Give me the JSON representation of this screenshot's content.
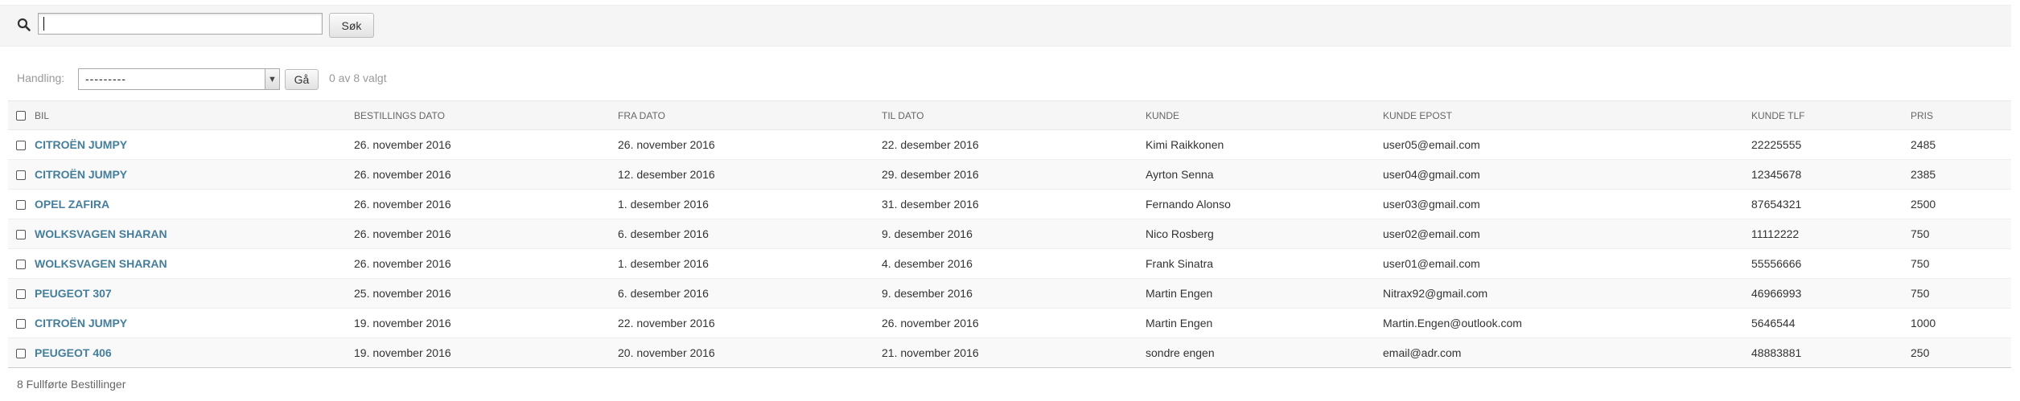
{
  "search": {
    "input_value": "",
    "button_label": "Søk"
  },
  "actions": {
    "label": "Handling:",
    "selected_option": "---------",
    "go_label": "Gå",
    "selection_count": "0 av 8 valgt"
  },
  "table": {
    "headers": [
      "Bil",
      "Bestillings dato",
      "Fra dato",
      "Til dato",
      "Kunde",
      "Kunde epost",
      "Kunde tlf",
      "Pris"
    ],
    "rows": [
      [
        "CITROËN JUMPY",
        "26. november 2016",
        "26. november 2016",
        "22. desember 2016",
        "Kimi Raikkonen",
        "user05@email.com",
        "22225555",
        "2485"
      ],
      [
        "CITROËN JUMPY",
        "26. november 2016",
        "12. desember 2016",
        "29. desember 2016",
        "Ayrton Senna",
        "user04@gmail.com",
        "12345678",
        "2385"
      ],
      [
        "OPEL ZAFIRA",
        "26. november 2016",
        "1. desember 2016",
        "31. desember 2016",
        "Fernando Alonso",
        "user03@gmail.com",
        "87654321",
        "2500"
      ],
      [
        "WOLKSVAGEN SHARAN",
        "26. november 2016",
        "6. desember 2016",
        "9. desember 2016",
        "Nico Rosberg",
        "user02@email.com",
        "11112222",
        "750"
      ],
      [
        "WOLKSVAGEN SHARAN",
        "26. november 2016",
        "1. desember 2016",
        "4. desember 2016",
        "Frank Sinatra",
        "user01@email.com",
        "55556666",
        "750"
      ],
      [
        "PEUGEOT 307",
        "25. november 2016",
        "6. desember 2016",
        "9. desember 2016",
        "Martin Engen",
        "Nitrax92@gmail.com",
        "46966993",
        "750"
      ],
      [
        "CITROËN JUMPY",
        "19. november 2016",
        "22. november 2016",
        "26. november 2016",
        "Martin Engen",
        "Martin.Engen@outlook.com",
        "5646544",
        "1000"
      ],
      [
        "PEUGEOT 406",
        "19. november 2016",
        "20. november 2016",
        "21. november 2016",
        "sondre engen",
        "email@adr.com",
        "48883881",
        "250"
      ]
    ]
  },
  "paginator": {
    "text": "8 Fullførte Bestillinger"
  },
  "colors": {
    "link": "#447e9b",
    "header_bg": "#f6f6f6",
    "muted_text": "#999999"
  },
  "icons": {
    "search": "search-icon",
    "dropdown": "chevron-down-icon"
  }
}
